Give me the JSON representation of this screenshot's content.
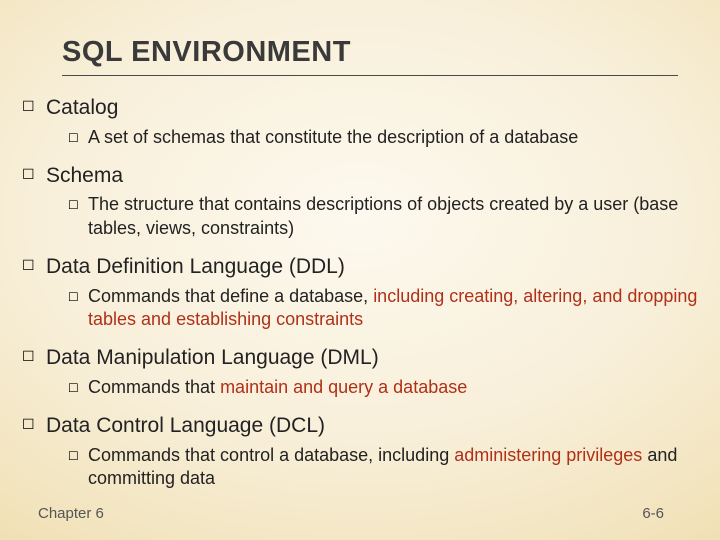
{
  "title": "SQL ENVIRONMENT",
  "items": [
    {
      "label": "Catalog",
      "sub": [
        {
          "pre": "A set of schemas that constitute the description of a database",
          "hl": "",
          "post": ""
        }
      ]
    },
    {
      "label": "Schema",
      "sub": [
        {
          "pre": "The structure that contains descriptions of objects created by a user (base tables, views, constraints)",
          "hl": "",
          "post": ""
        }
      ]
    },
    {
      "label": "Data Definition Language (DDL)",
      "sub": [
        {
          "pre": "Commands that define a database, ",
          "hl": "including creating, altering, and dropping tables and establishing constraints",
          "post": ""
        }
      ]
    },
    {
      "label": "Data Manipulation Language (DML)",
      "sub": [
        {
          "pre": "Commands that ",
          "hl": "maintain and query a database",
          "post": ""
        }
      ]
    },
    {
      "label": "Data Control Language (DCL)",
      "sub": [
        {
          "pre": "Commands that control a database, including ",
          "hl": "administering privileges",
          "post": " and committing data"
        }
      ]
    }
  ],
  "footer": {
    "left": "Chapter 6",
    "right": "6-6"
  },
  "bullet": "☐"
}
